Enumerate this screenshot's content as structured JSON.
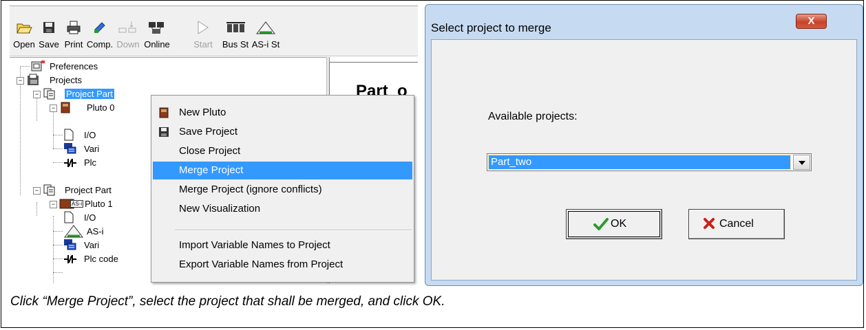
{
  "toolbar": {
    "buttons": [
      {
        "label": "Open",
        "icon": "open-folder-icon"
      },
      {
        "label": "Save",
        "icon": "save-icon"
      },
      {
        "label": "Print",
        "icon": "print-icon"
      },
      {
        "label": "Comp.",
        "icon": "compile-icon"
      },
      {
        "label": "Down",
        "icon": "download-icon",
        "disabled": true
      },
      {
        "label": "Online",
        "icon": "online-icon"
      },
      {
        "label": "Start",
        "icon": "start-icon",
        "disabled": true
      },
      {
        "label": "Bus St",
        "icon": "bus-status-icon"
      },
      {
        "label": "AS-i St",
        "icon": "asi-status-icon"
      }
    ]
  },
  "tree": {
    "preferences": "Preferences",
    "projects": "Projects",
    "project_1": "Project Part",
    "pluto_0": "Pluto 0",
    "io_1": "I/O",
    "vari_1": "Vari",
    "plc_1": "Plc",
    "project_2": "Project Part",
    "asi_badge": "AS-i",
    "pluto_1": "Pluto 1",
    "io_2": "I/O",
    "asi_2": "AS-i",
    "vari_2": "Vari",
    "plc_code": "Plc code"
  },
  "right_view": {
    "heading": "Part_o"
  },
  "context_menu": {
    "items": [
      {
        "label": "New Pluto",
        "icon": "pluto-icon"
      },
      {
        "label": "Save Project",
        "icon": "save-icon"
      },
      {
        "label": "Close Project"
      },
      {
        "label": "Merge Project",
        "highlighted": true
      },
      {
        "label": "Merge Project (ignore conflicts)"
      },
      {
        "label": "New Visualization"
      },
      {
        "label": "Import Variable Names to Project"
      },
      {
        "label": "Export Variable Names from Project"
      }
    ]
  },
  "dialog": {
    "title": "Select project to merge",
    "close_symbol": "X",
    "available_label": "Available projects:",
    "selected_project": "Part_two",
    "ok_label": "OK",
    "cancel_label": "Cancel"
  },
  "caption": "Click “Merge Project”, select the project that shall be merged, and click OK.",
  "colors": {
    "selection": "#3399ff",
    "dialog_frame": "#c6dbf1",
    "ok_check": "#2e9a2e",
    "cancel_x": "#c8201a"
  }
}
